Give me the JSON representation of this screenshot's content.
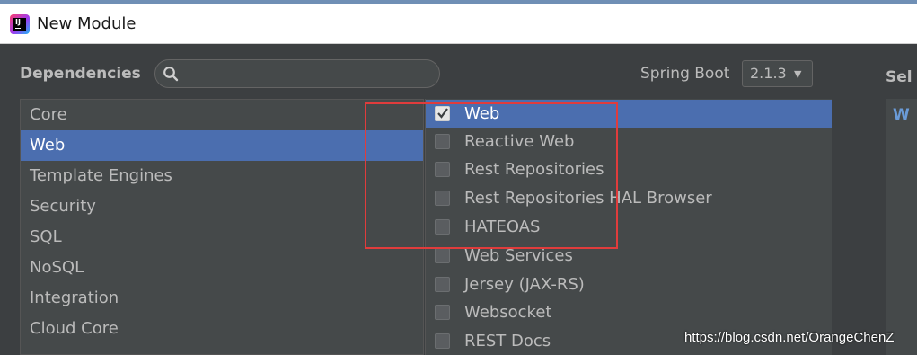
{
  "window": {
    "title": "New Module"
  },
  "header": {
    "dependencies_label": "Dependencies",
    "search": {
      "placeholder": "",
      "value": ""
    },
    "spring_boot_label": "Spring Boot",
    "spring_boot_version": "2.1.3",
    "selected_label": "Sel"
  },
  "categories": [
    {
      "label": "Core",
      "selected": false
    },
    {
      "label": "Web",
      "selected": true
    },
    {
      "label": "Template Engines",
      "selected": false
    },
    {
      "label": "Security",
      "selected": false
    },
    {
      "label": "SQL",
      "selected": false
    },
    {
      "label": "NoSQL",
      "selected": false
    },
    {
      "label": "Integration",
      "selected": false
    },
    {
      "label": "Cloud Core",
      "selected": false
    }
  ],
  "dependencies": [
    {
      "label": "Web",
      "checked": true,
      "selected": true
    },
    {
      "label": "Reactive Web",
      "checked": false,
      "selected": false
    },
    {
      "label": "Rest Repositories",
      "checked": false,
      "selected": false
    },
    {
      "label": "Rest Repositories HAL Browser",
      "checked": false,
      "selected": false
    },
    {
      "label": "HATEOAS",
      "checked": false,
      "selected": false
    },
    {
      "label": "Web Services",
      "checked": false,
      "selected": false
    },
    {
      "label": "Jersey (JAX-RS)",
      "checked": false,
      "selected": false
    },
    {
      "label": "Websocket",
      "checked": false,
      "selected": false
    },
    {
      "label": "REST Docs",
      "checked": false,
      "selected": false
    }
  ],
  "selected_dependencies": {
    "first": "W"
  },
  "watermark": "https://blog.csdn.net/OrangeChenZ",
  "colors": {
    "accent": "#4b6eaf",
    "annotation": "#e03c3c",
    "panel": "#3c3f41"
  },
  "icons": {
    "app": "intellij-idea-icon",
    "search": "search-icon",
    "dropdown": "chevron-down-icon",
    "check": "checkmark-icon"
  }
}
